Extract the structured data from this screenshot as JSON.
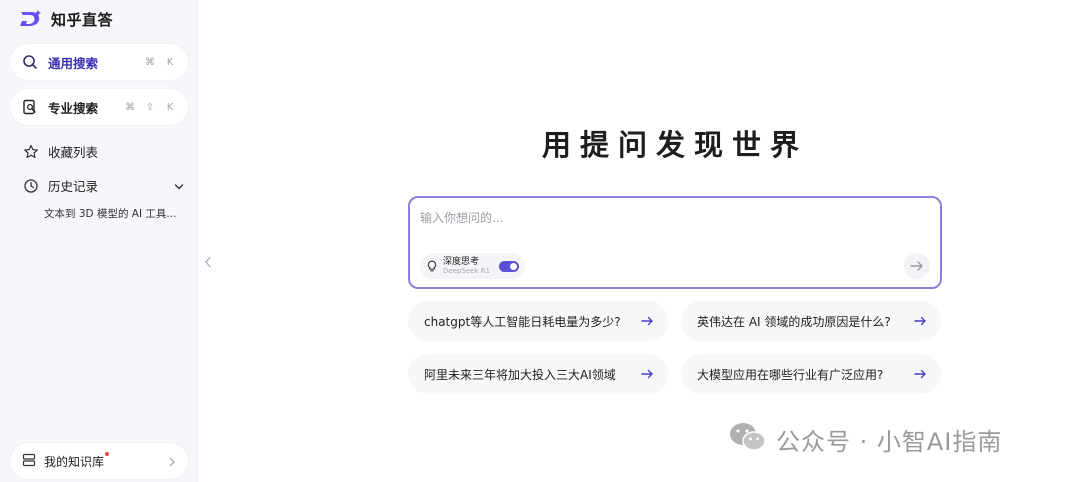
{
  "brand": {
    "name": "知乎直答",
    "color": "#6a4cf0"
  },
  "sidebar": {
    "search_general": {
      "label": "通用搜索",
      "keys": [
        "⌘",
        "K"
      ]
    },
    "search_pro": {
      "label": "专业搜索",
      "keys": [
        "⌘",
        "⇧",
        "K"
      ]
    },
    "favorites": {
      "label": "收藏列表"
    },
    "history": {
      "label": "历史记录",
      "items": [
        "文本到 3D 模型的 AI 工具..."
      ]
    },
    "knowledge_base": {
      "label": "我的知识库"
    }
  },
  "main": {
    "hero": "用提问发现世界",
    "input": {
      "placeholder": "输入你想问的..."
    },
    "deep_think": {
      "label": "深度思考",
      "model": "DeepSeek R1",
      "enabled": true
    },
    "suggestions": [
      "chatgpt等人工智能日耗电量为多少?",
      "英伟达在 AI 领域的成功原因是什么?",
      "阿里未来三年将加大投入三大AI领域",
      "大模型应用在哪些行业有广泛应用?"
    ]
  },
  "watermark": "公众号 · 小智AI指南",
  "colors": {
    "accent": "#5b4fd6",
    "input_border": "#8b7fdc",
    "notify": "#e3463b"
  }
}
